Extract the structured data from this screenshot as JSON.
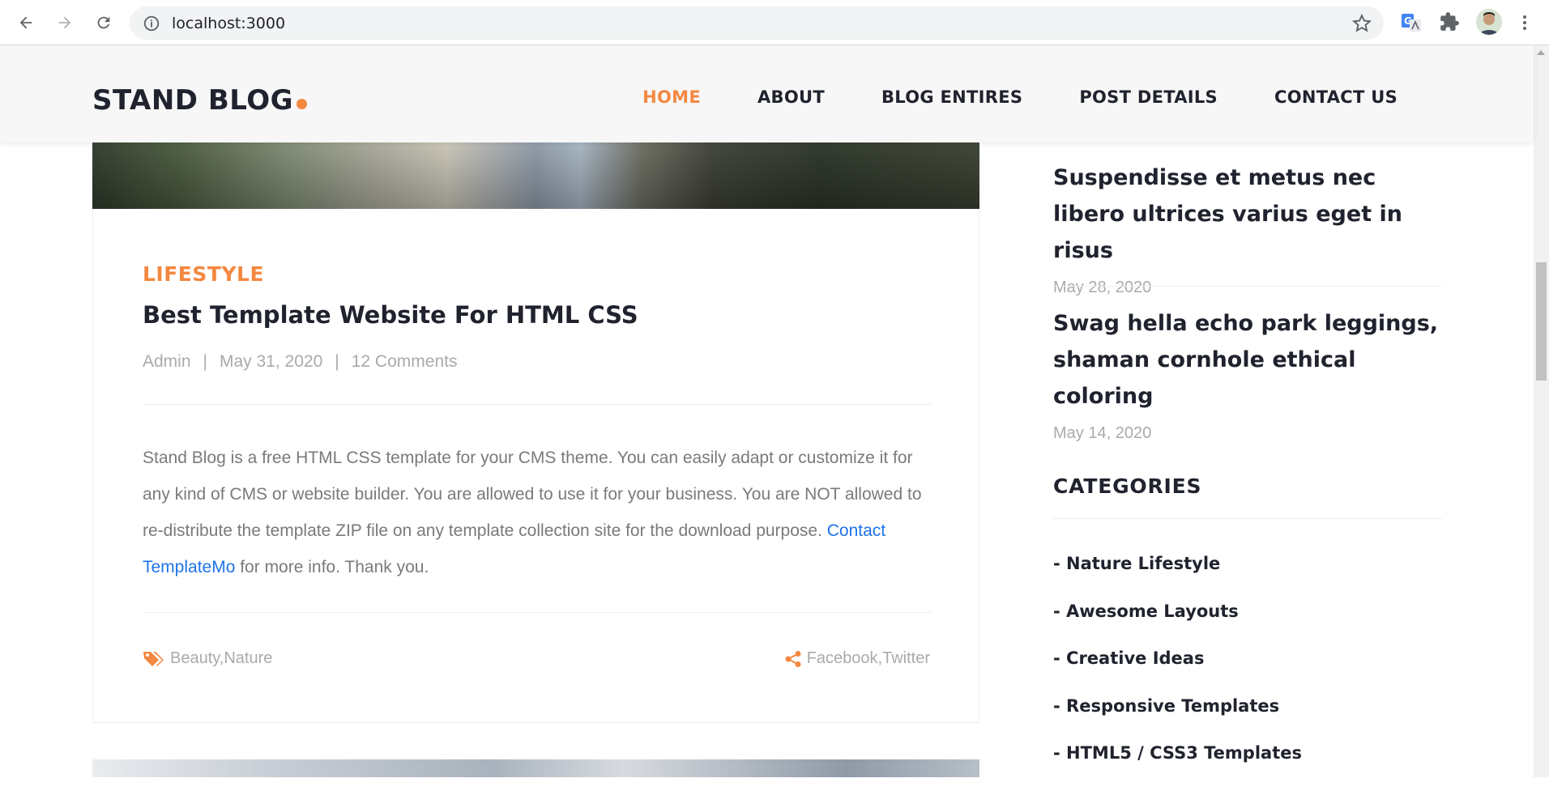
{
  "browser": {
    "url": "localhost:3000"
  },
  "header": {
    "logo": "STAND BLOG",
    "nav": [
      {
        "label": "HOME",
        "active": true
      },
      {
        "label": "ABOUT",
        "active": false
      },
      {
        "label": "BLOG ENTIRES",
        "active": false
      },
      {
        "label": "POST DETAILS",
        "active": false
      },
      {
        "label": "CONTACT US",
        "active": false
      }
    ]
  },
  "post": {
    "category": "LIFESTYLE",
    "title": "Best Template Website For HTML CSS",
    "author": "Admin",
    "separator": "|",
    "date": "May 31, 2020",
    "comments": "12 Comments",
    "body_before_link": "Stand Blog is a free HTML CSS template for your CMS theme. You can easily adapt or customize it for any kind of CMS or website builder. You are allowed to use it for your business. You are NOT allowed to re-distribute the template ZIP file on any template collection site for the download purpose. ",
    "body_link": "Contact TemplateMo",
    "body_after_link": " for more info. Thank you.",
    "tags": "Beauty,Nature",
    "shares": "Facebook,Twitter"
  },
  "sidebar": {
    "recent_posts": [
      {
        "title": "Suspendisse et metus nec libero ultrices varius eget in risus",
        "date": "May 28, 2020"
      },
      {
        "title": "Swag hella echo park leggings, shaman cornhole ethical coloring",
        "date": "May 14, 2020"
      }
    ],
    "categories_heading": "CATEGORIES",
    "categories": [
      "- Nature Lifestyle",
      "- Awesome Layouts",
      "- Creative Ideas",
      "- Responsive Templates",
      "- HTML5 / CSS3 Templates"
    ]
  },
  "colors": {
    "accent": "#f48840",
    "text_dark": "#20232e",
    "text_muted": "#aaaaaa",
    "link": "#1e73e8"
  },
  "icons": [
    "back-arrow-icon",
    "forward-arrow-icon",
    "reload-icon",
    "info-icon",
    "star-icon",
    "translate-icon",
    "puzzle-icon",
    "avatar",
    "kebab-menu-icon",
    "tags-icon",
    "share-icon"
  ]
}
